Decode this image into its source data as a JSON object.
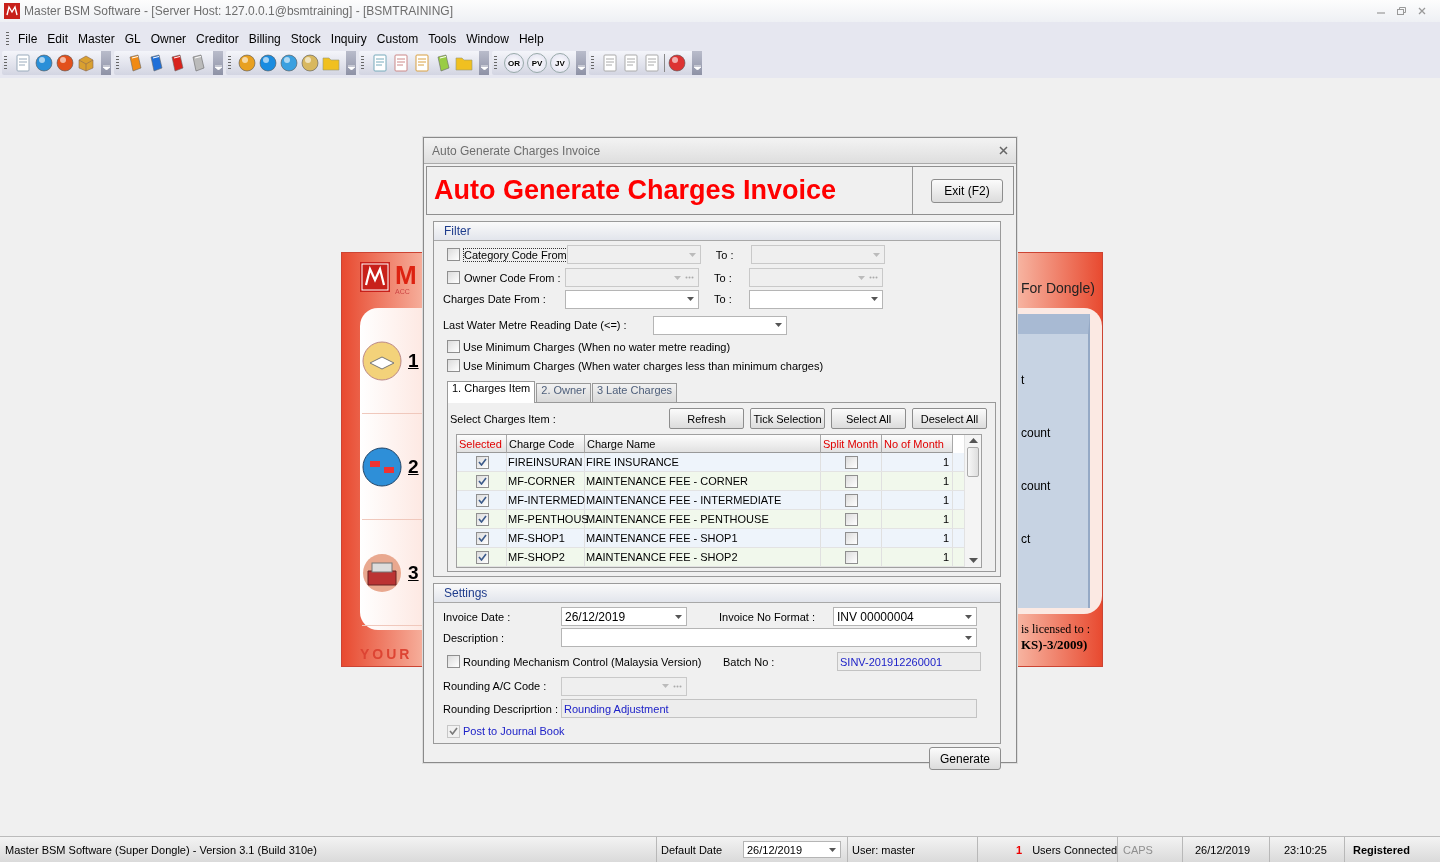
{
  "window": {
    "title": "Master BSM Software - [Server Host: 127.0.0.1@bsmtraining] - [BSMTRAINING]"
  },
  "menu": [
    "File",
    "Edit",
    "Master",
    "GL",
    "Owner",
    "Creditor",
    "Billing",
    "Stock",
    "Inquiry",
    "Custom",
    "Tools",
    "Window",
    "Help"
  ],
  "toolbar": [
    {
      "kind": "icons"
    },
    {
      "kind": "icons"
    },
    {
      "kind": "icons"
    },
    {
      "kind": "icons"
    },
    {
      "kind": "labels",
      "labels": [
        "OR",
        "PV",
        "JV"
      ]
    },
    {
      "kind": "icons"
    }
  ],
  "background_window": {
    "logo": "M",
    "logo_sub": "ACC",
    "left_items": [
      "1",
      "2",
      "3"
    ],
    "footer": "YOUR",
    "title_fragment": "For Dongle)",
    "right_items": [
      "t",
      "count",
      "count",
      "ct"
    ],
    "license_label": "is licensed to :",
    "license_value": "KS)-3/2009)"
  },
  "dialog": {
    "title": "Auto Generate Charges Invoice",
    "heading": "Auto Generate Charges Invoice",
    "exit_button": "Exit (F2)",
    "filter": {
      "title": "Filter",
      "rows": [
        {
          "kind": "check_range",
          "label": "Category Code From",
          "checked": false,
          "focused": true,
          "disabled": true,
          "ellipsis": false,
          "to_label": "To :"
        },
        {
          "kind": "check_range",
          "label": "Owner Code From :",
          "checked": false,
          "focused": false,
          "disabled": true,
          "ellipsis": true,
          "to_label": "To :"
        },
        {
          "kind": "range",
          "label": "Charges Date From :",
          "focused": false,
          "disabled": false,
          "ellipsis": false,
          "to_label": "To :"
        },
        {
          "kind": "single",
          "label": "Last Water Metre Reading Date (<=) :"
        },
        {
          "kind": "check",
          "label": "Use Minimum Charges (When no water metre reading)",
          "checked": false
        },
        {
          "kind": "check",
          "label": "Use Minimum Charges (When water charges less than minimum charges)",
          "checked": false
        }
      ]
    },
    "tabs": [
      {
        "label": "1. Charges Item",
        "selected": true
      },
      {
        "label": "2. Owner",
        "selected": false
      },
      {
        "label": "3 Late Charges",
        "selected": false
      }
    ],
    "charges": {
      "label": "Select Charges Item :",
      "buttons": [
        "Refresh",
        "Tick Selection",
        "Select All",
        "Deselect All"
      ],
      "columns": [
        {
          "label": "Selected",
          "color": "#e00000"
        },
        {
          "label": "Charge Code",
          "color": "#000000"
        },
        {
          "label": "Charge Name",
          "color": "#000000"
        },
        {
          "label": "Split Month",
          "color": "#e00000"
        },
        {
          "label": "No of Month",
          "color": "#e00000"
        }
      ],
      "rows": [
        {
          "selected": true,
          "code": "FIREINSURAN",
          "name": "FIRE INSURANCE",
          "split_month": false,
          "months": "1"
        },
        {
          "selected": true,
          "code": "MF-CORNER",
          "name": "MAINTENANCE FEE - CORNER",
          "split_month": false,
          "months": "1"
        },
        {
          "selected": true,
          "code": "MF-INTERMED",
          "name": "MAINTENANCE FEE - INTERMEDIATE",
          "split_month": false,
          "months": "1"
        },
        {
          "selected": true,
          "code": "MF-PENTHOUS",
          "name": "MAINTENANCE FEE - PENTHOUSE",
          "split_month": false,
          "months": "1"
        },
        {
          "selected": true,
          "code": "MF-SHOP1",
          "name": "MAINTENANCE FEE - SHOP1",
          "split_month": false,
          "months": "1"
        },
        {
          "selected": true,
          "code": "MF-SHOP2",
          "name": "MAINTENANCE FEE - SHOP2",
          "split_month": false,
          "months": "1"
        }
      ]
    },
    "settings": {
      "title": "Settings",
      "invoice_date_label": "Invoice Date :",
      "invoice_date": "26/12/2019",
      "invoice_no_format_label": "Invoice No Format :",
      "invoice_no_format": "INV 00000004",
      "description_label": "Description :",
      "rounding_control": {
        "label": "Rounding Mechanism Control (Malaysia Version)",
        "checked": false
      },
      "batch_no_label": "Batch No :",
      "batch_no": "SINV-201912260001",
      "rounding_ac_code_label": "Rounding A/C Code :",
      "rounding_description_label": "Rounding Descriprtion :",
      "rounding_description": "Rounding Adjustment",
      "post_to_journal": {
        "label": "Post to Journal Book",
        "checked": true,
        "disabled": true
      }
    },
    "generate_button": "Generate"
  },
  "status_bar": {
    "app_info": "Master BSM Software (Super Dongle) - Version 3.1 (Build 310e)",
    "default_date_label": "Default Date",
    "default_date": "26/12/2019",
    "user": "User: master",
    "users_count": "1",
    "users_label": "Users Connected",
    "caps": {
      "label": "CAPS",
      "on": false
    },
    "date": "26/12/2019",
    "time": "23:10:25",
    "registration": "Registered"
  }
}
